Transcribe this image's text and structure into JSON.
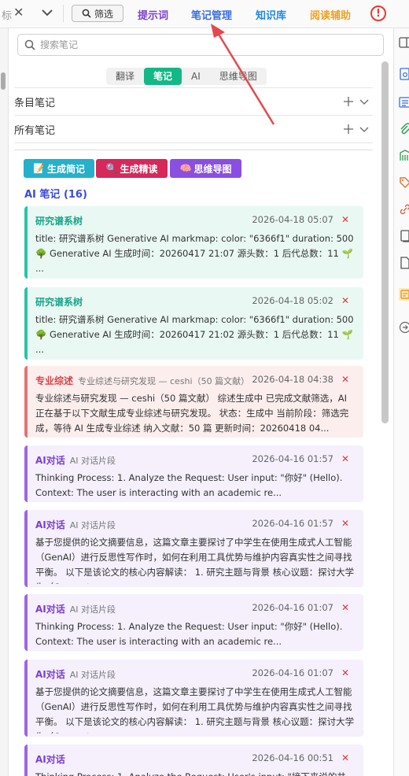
{
  "toolbar": {
    "stub": "标",
    "filter": "筛选",
    "tabs": [
      {
        "label": "提示词",
        "color": "#7b3fd0"
      },
      {
        "label": "笔记管理",
        "color": "#3b6fe0"
      },
      {
        "label": "知识库",
        "color": "#1e88e5"
      },
      {
        "label": "阅读辅助",
        "color": "#f0a020"
      }
    ],
    "warn": "!"
  },
  "search": {
    "placeholder": "搜索笔记"
  },
  "seg_tabs": [
    {
      "label": "翻译",
      "active": false
    },
    {
      "label": "笔记",
      "active": true
    },
    {
      "label": "AI",
      "active": false
    },
    {
      "label": "思维导图",
      "active": false
    }
  ],
  "sections": [
    {
      "label": "条目笔记"
    },
    {
      "label": "所有笔记"
    }
  ],
  "actions": [
    {
      "label": "生成简记",
      "emoji": "📝",
      "color": "#26b0c9"
    },
    {
      "label": "生成精读",
      "emoji": "🔍",
      "color": "#d6285a"
    },
    {
      "label": "思维导图",
      "emoji": "🧠",
      "color": "#8a4fe0"
    }
  ],
  "ai_notes_title": "AI 笔记 (16)",
  "cards": [
    {
      "kind": "tree",
      "title": "研究谱系树",
      "sub": "",
      "date": "2026-04-18 05:07",
      "body": "title: 研究谱系树 Generative AI markmap: color: \"6366f1\" duration: 500 🌳 Generative AI 生成时间：20260417 21:07 源头数：1 后代总数：11 🌱 ..."
    },
    {
      "kind": "tree",
      "title": "研究谱系树",
      "sub": "",
      "date": "2026-04-18 05:02",
      "body": "title: 研究谱系树 Generative AI markmap: color: \"6366f1\" duration: 500 🌳 Generative AI 生成时间：20260417 21:02 源头数：1 后代总数：11 🌱 ..."
    },
    {
      "kind": "review",
      "title": "专业综述",
      "sub": "专业综述与研究发现 — ceshi（50 篇文献）",
      "date": "2026-04-18 04:38",
      "body": "专业综述与研究发现 — ceshi（50 篇文献） 综述生成中 已完成文献筛选，AI 正在基于以下文献生成专业综述与研究发现。 状态：生成中 当前阶段：筛选完成，等待 AI 生成专业综述 纳入文献：50 篇 更新时间：20260418 04..."
    },
    {
      "kind": "ai",
      "title": "AI对话",
      "sub": "AI 对话片段",
      "date": "2026-04-16 01:57",
      "body": "Thinking Process: 1. Analyze the Request: User input: \"你好\" (Hello). Context: The user is interacting with an academic re..."
    },
    {
      "kind": "ai",
      "title": "AI对话",
      "sub": "AI 对话片段",
      "date": "2026-04-16 01:57",
      "body": "基于您提供的论文摘要信息，这篇文章主要探讨了中学生在使用生成式人工智能（GenAI）进行反思性写作时，如何在利用工具优势与维护内容真实性之间寻找平衡。 以下是该论文的核心内容解读： 1. 研究主题与背景 核心议题：探讨大学生（Generat..."
    },
    {
      "kind": "ai",
      "title": "AI对话",
      "sub": "AI 对话片段",
      "date": "2026-04-16 01:07",
      "body": "Thinking Process: 1. Analyze the Request: User input: \"你好\" (Hello). Context: The user is interacting with an academic re..."
    },
    {
      "kind": "ai",
      "title": "AI对话",
      "sub": "AI 对话片段",
      "date": "2026-04-16 01:07",
      "body": "基于您提供的论文摘要信息，这篇文章主要探讨了中学生在使用生成式人工智能（GenAI）进行反思性写作时，如何在利用工具优势与维护内容真实性之间寻找平衡。 以下是该论文的核心内容解读： 1. 研究主题与背景 核心议题：探讨大学生（Generat..."
    },
    {
      "kind": "ai",
      "title": "AI对话",
      "sub": "",
      "date": "2026-04-16 00:51",
      "body": "Thinking Process: 1. Analyze the Request: User's input: \"接下来说的共..."
    }
  ]
}
